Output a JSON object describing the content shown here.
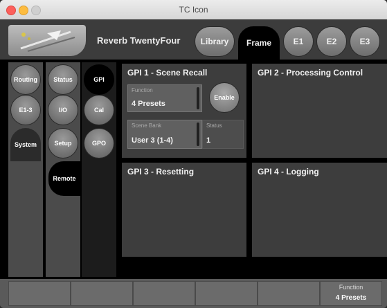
{
  "window": {
    "title": "TC Icon"
  },
  "header": {
    "app_name": "Reverb TwentyFour",
    "tabs": [
      {
        "label": "Library"
      },
      {
        "label": "Frame"
      },
      {
        "label": "E1"
      },
      {
        "label": "E2"
      },
      {
        "label": "E3"
      }
    ]
  },
  "sidebar": {
    "col1": [
      {
        "label": "Routing"
      },
      {
        "label": "E1-3"
      },
      {
        "label": "System"
      }
    ],
    "col2": [
      {
        "label": "Status"
      },
      {
        "label": "I/O"
      },
      {
        "label": "Setup"
      },
      {
        "label": "Remote"
      }
    ],
    "col3": [
      {
        "label": "GPI"
      },
      {
        "label": "Cal"
      },
      {
        "label": "GPO"
      }
    ]
  },
  "panels": {
    "gpi1": {
      "title": "GPI 1 - Scene Recall",
      "function_label": "Function",
      "function_value": "4 Presets",
      "enable_label": "Enable",
      "scene_bank_label": "Scene Bank",
      "scene_bank_value": "User 3 (1-4)",
      "status_label": "Status",
      "status_value": "1"
    },
    "gpi2": {
      "title": "GPI 2 - Processing Control"
    },
    "gpi3": {
      "title": "GPI 3 - Resetting"
    },
    "gpi4": {
      "title": "GPI 4 - Logging"
    }
  },
  "footer": {
    "function_label": "Function",
    "function_value": "4 Presets"
  }
}
